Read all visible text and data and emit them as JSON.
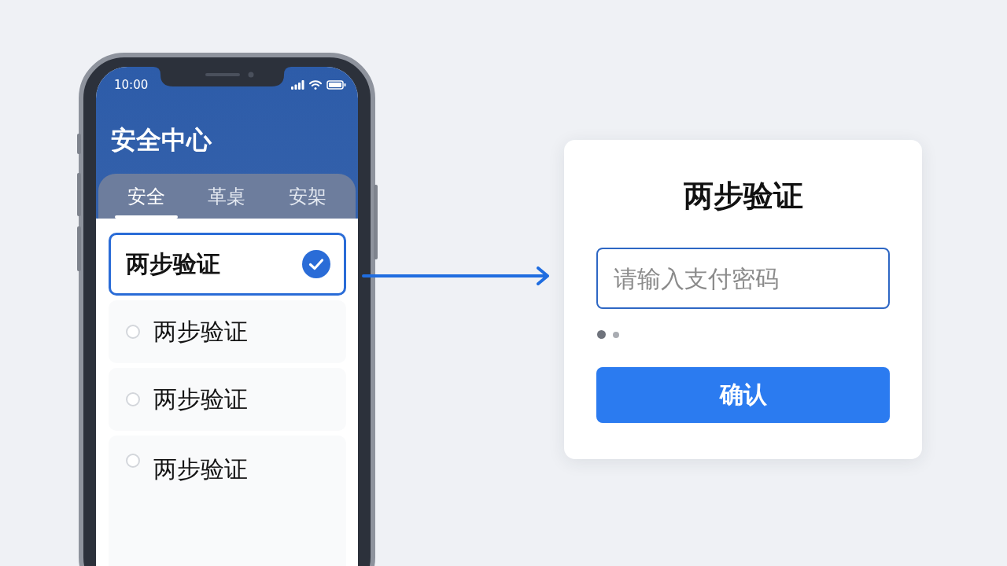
{
  "phone": {
    "status_bar": {
      "time": "10:00"
    },
    "header": {
      "title": "安全中心"
    },
    "tabs": [
      {
        "label": "安全",
        "selected": true
      },
      {
        "label": "革桌",
        "selected": false
      },
      {
        "label": "安架",
        "selected": false
      }
    ],
    "options": [
      {
        "label": "两步验证",
        "selected": true
      },
      {
        "label": "两步验证",
        "selected": false
      },
      {
        "label": "两步验证",
        "selected": false
      },
      {
        "label": "两步验证",
        "selected": false
      }
    ]
  },
  "dialog": {
    "title": "两步验证",
    "password_field": {
      "placeholder": "请输入支付密码"
    },
    "step_dots": [
      {
        "selected": true
      },
      {
        "selected": false
      }
    ],
    "confirm_button": "确认"
  }
}
